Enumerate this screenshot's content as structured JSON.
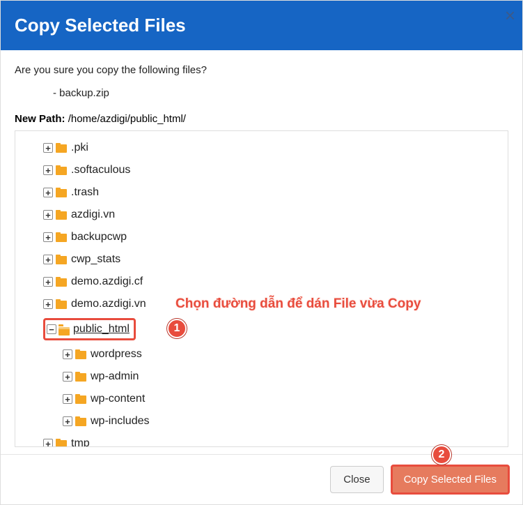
{
  "header": {
    "title": "Copy Selected Files",
    "close": "×"
  },
  "body": {
    "confirm": "Are you sure you copy the following files?",
    "file_prefix": "- ",
    "files": [
      "backup.zip"
    ],
    "path_label": "New Path: ",
    "path_value": "/home/azdigi/public_html/"
  },
  "tree": {
    "items": [
      {
        "indent": 1,
        "toggle": "+",
        "open": false,
        "name": ".pki"
      },
      {
        "indent": 1,
        "toggle": "+",
        "open": false,
        "name": ".softaculous"
      },
      {
        "indent": 1,
        "toggle": "+",
        "open": false,
        "name": ".trash"
      },
      {
        "indent": 1,
        "toggle": "+",
        "open": false,
        "name": "azdigi.vn"
      },
      {
        "indent": 1,
        "toggle": "+",
        "open": false,
        "name": "backupcwp"
      },
      {
        "indent": 1,
        "toggle": "+",
        "open": false,
        "name": "cwp_stats"
      },
      {
        "indent": 1,
        "toggle": "+",
        "open": false,
        "name": "demo.azdigi.cf"
      },
      {
        "indent": 1,
        "toggle": "+",
        "open": false,
        "name": "demo.azdigi.vn"
      },
      {
        "indent": 1,
        "toggle": "−",
        "open": true,
        "name": "public_html",
        "selected": true
      },
      {
        "indent": 2,
        "toggle": "+",
        "open": false,
        "name": "wordpress"
      },
      {
        "indent": 2,
        "toggle": "+",
        "open": false,
        "name": "wp-admin"
      },
      {
        "indent": 2,
        "toggle": "+",
        "open": false,
        "name": "wp-content"
      },
      {
        "indent": 2,
        "toggle": "+",
        "open": false,
        "name": "wp-includes"
      },
      {
        "indent": 1,
        "toggle": "+",
        "open": false,
        "name": "tmp"
      }
    ]
  },
  "annotations": {
    "text": "Chọn đường dẫn để dán File vừa Copy",
    "badge1": "1",
    "badge2": "2"
  },
  "footer": {
    "close": "Close",
    "confirm": "Copy Selected Files"
  }
}
